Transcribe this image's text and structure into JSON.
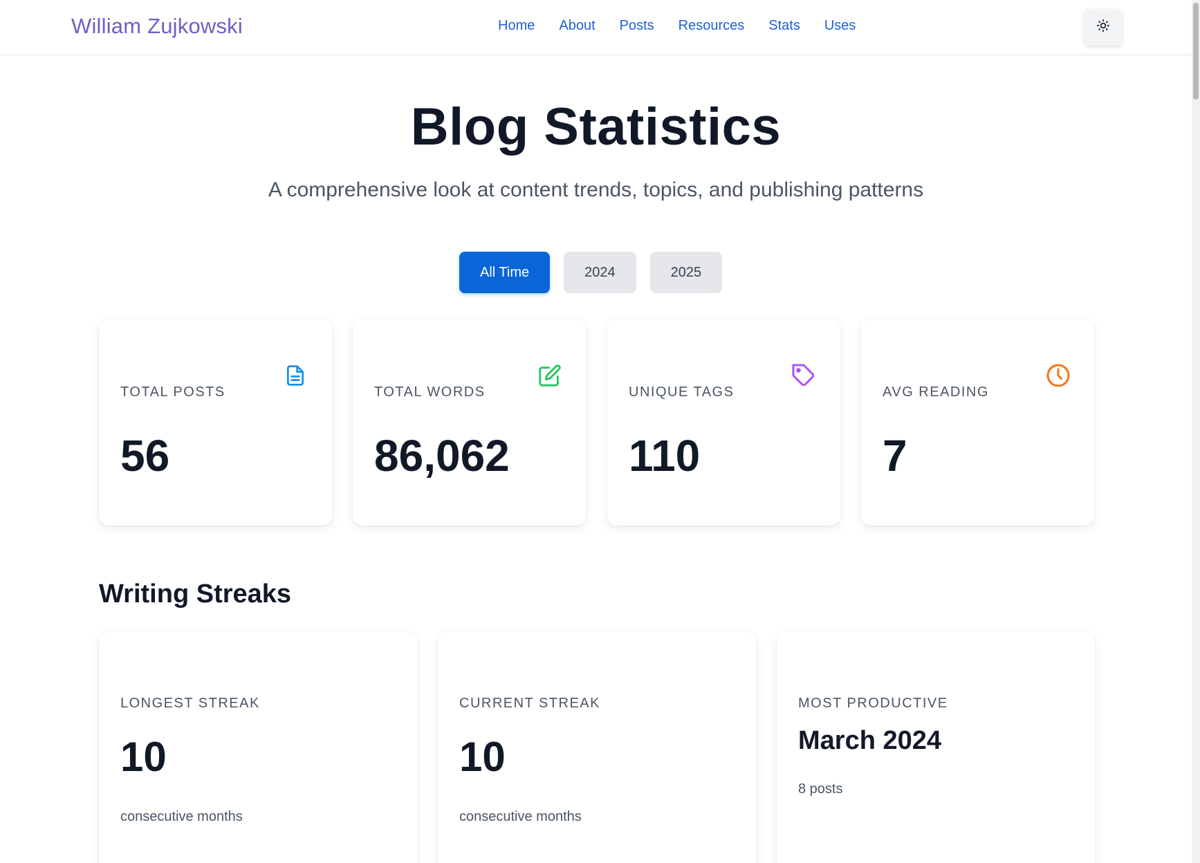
{
  "header": {
    "brand": "William Zujkowski",
    "nav": [
      "Home",
      "About",
      "Posts",
      "Resources",
      "Stats",
      "Uses"
    ],
    "theme_toggle_icon": "sun-icon"
  },
  "hero": {
    "title": "Blog Statistics",
    "subtitle": "A comprehensive look at content trends, topics, and publishing patterns"
  },
  "filters": {
    "options": [
      "All Time",
      "2024",
      "2025"
    ],
    "selected": "All Time"
  },
  "stats": [
    {
      "label": "Total Posts",
      "value": "56",
      "icon": "document-icon",
      "color": "#0f8fe8"
    },
    {
      "label": "Total Words",
      "value": "86,062",
      "icon": "edit-icon",
      "color": "#22c55e"
    },
    {
      "label": "Unique Tags",
      "value": "110",
      "icon": "tag-icon",
      "color": "#a855f7"
    },
    {
      "label": "Avg Reading",
      "value": "7",
      "icon": "clock-icon",
      "color": "#f97316"
    }
  ],
  "streaks": {
    "section_title": "Writing Streaks",
    "items": [
      {
        "label": "Longest Streak",
        "value": "10",
        "note": "consecutive months"
      },
      {
        "label": "Current Streak",
        "value": "10",
        "note": "consecutive months"
      },
      {
        "label": "Most Productive",
        "value": "March 2024",
        "note": "8 posts"
      }
    ]
  }
}
